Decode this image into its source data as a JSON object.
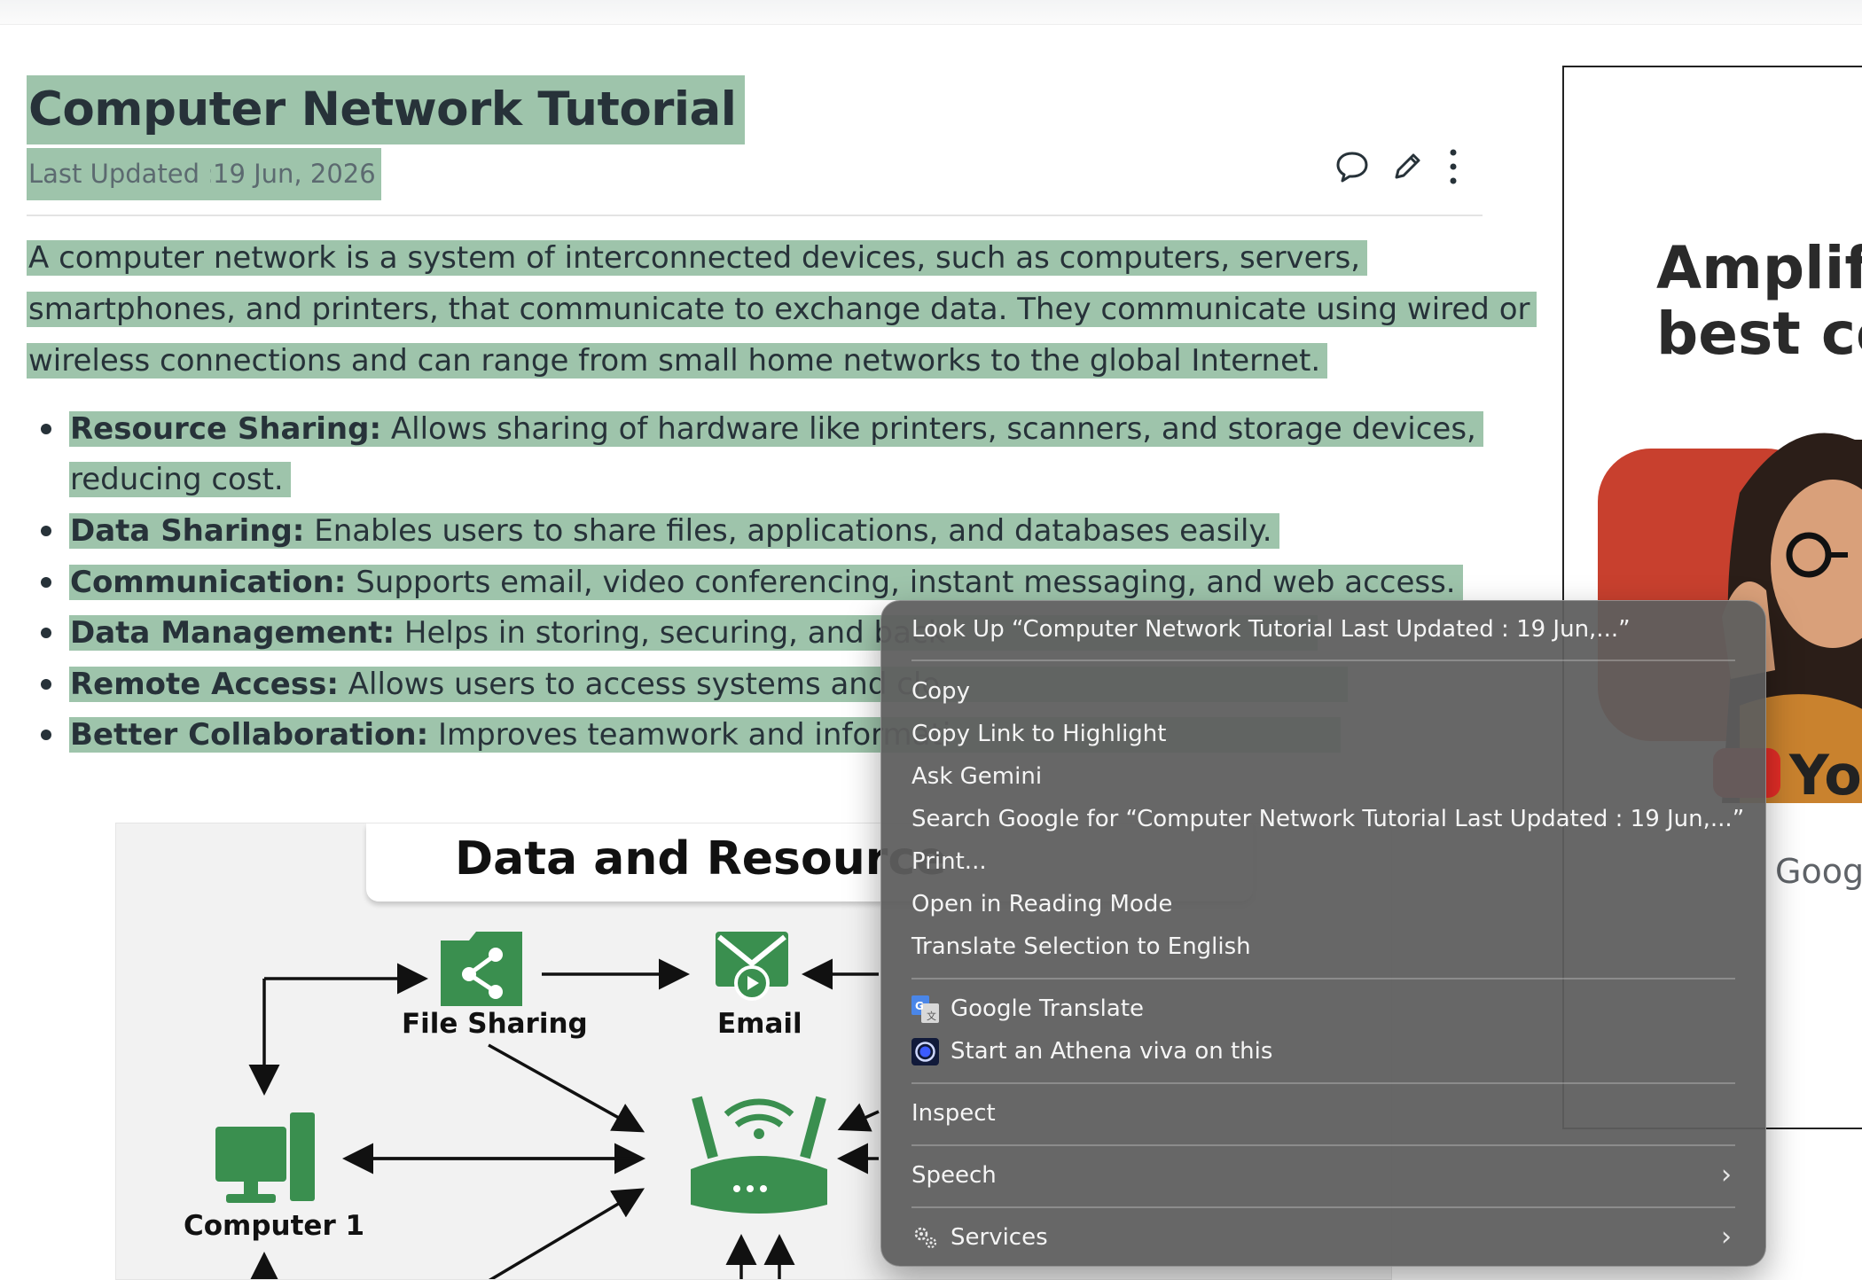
{
  "article": {
    "title": "Computer Network Tutorial",
    "last_updated_label": "Last Updated :",
    "last_updated_date": "19 Jun, 2026",
    "intro_lines": [
      "A computer network is a system of interconnected devices, such as computers, servers,",
      "smartphones, and printers, that communicate to exchange data. They communicate using wired or",
      "wireless connections and can range from small home networks to the global Internet."
    ],
    "bullets": [
      {
        "term": "Resource Sharing:",
        "text": " Allows sharing of hardware like printers, scanners, and storage devices,",
        "cont": "reducing cost."
      },
      {
        "term": "Data Sharing:",
        "text": " Enables users to share files, applications, and databases easily."
      },
      {
        "term": "Communication:",
        "text": " Supports email, video conferencing, instant messaging, and web access."
      },
      {
        "term": "Data Management:",
        "text": " Helps in storing, securing, and back"
      },
      {
        "term": "Remote Access:",
        "text": " Allows users to access systems and clo"
      },
      {
        "term": "Better Collaboration:",
        "text": " Improves teamwork and informati"
      }
    ]
  },
  "diagram": {
    "title": "Data and Resource",
    "labels": {
      "file_sharing": "File Sharing",
      "email": "Email",
      "computer1": "Computer 1"
    }
  },
  "ad": {
    "headline_1": "Amplify",
    "headline_2": "best co",
    "yt_text": "Yo",
    "google_text": "Googl"
  },
  "context_menu": {
    "look_up": "Look Up “Computer Network Tutorial Last Updated : 19 Jun,...”",
    "copy": "Copy",
    "copy_link": "Copy Link to Highlight",
    "ask_gemini": "Ask Gemini",
    "search_google": "Search Google for “Computer Network Tutorial Last Updated : 19 Jun,...”",
    "print": "Print...",
    "reading_mode": "Open in Reading Mode",
    "translate": "Translate Selection to English",
    "google_translate": "Google Translate",
    "athena": "Start an Athena viva on this",
    "inspect": "Inspect",
    "speech": "Speech",
    "services": "Services"
  },
  "colors": {
    "highlight": "#9ec4ab",
    "diagram_green": "#3a8f4f",
    "menu_bg": "#5e5e5e"
  }
}
